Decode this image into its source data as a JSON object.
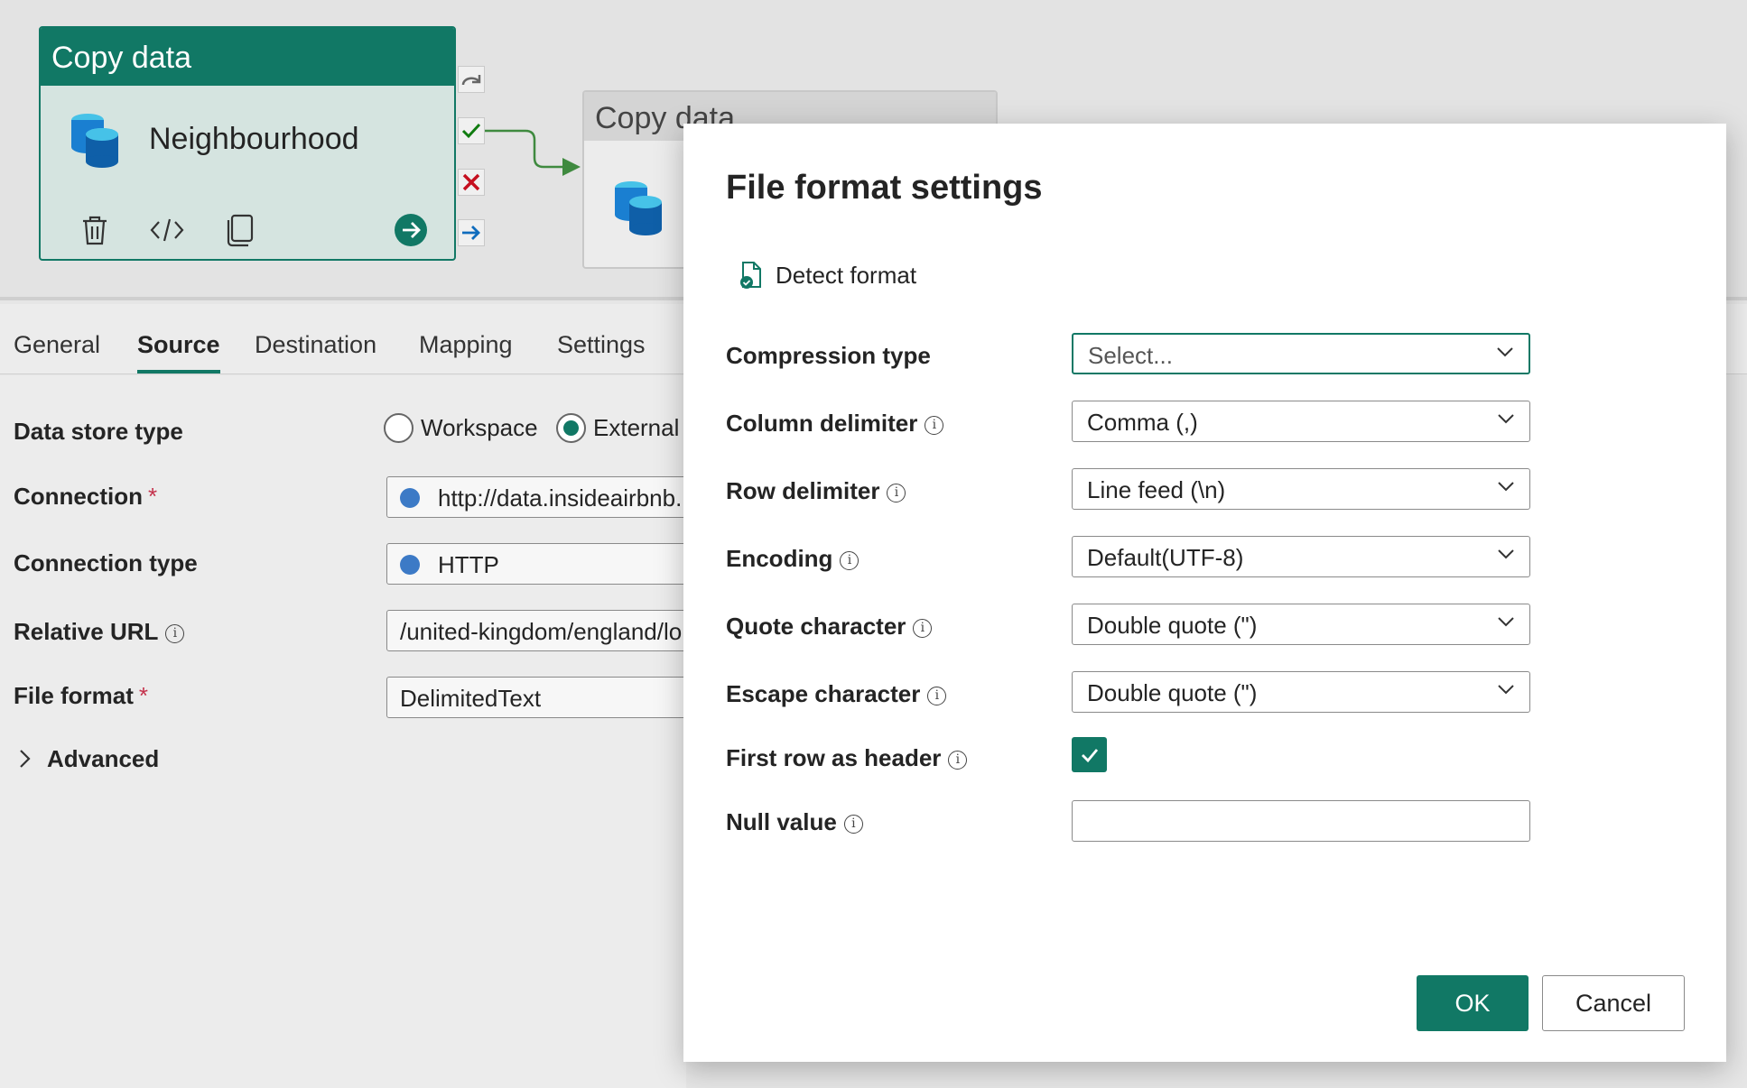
{
  "pipeline": {
    "node1": {
      "header": "Copy data",
      "title": "Neighbourhood"
    },
    "node2": {
      "header": "Copy data"
    }
  },
  "tabs": [
    {
      "label": "General"
    },
    {
      "label": "Source"
    },
    {
      "label": "Destination"
    },
    {
      "label": "Mapping"
    },
    {
      "label": "Settings"
    }
  ],
  "source": {
    "data_store_type_label": "Data store type",
    "workspace_option": "Workspace",
    "external_option": "External",
    "connection_label": "Connection",
    "connection_value": "http://data.insideairbnb.",
    "connection_type_label": "Connection type",
    "connection_type_value": "HTTP",
    "relative_url_label": "Relative URL",
    "relative_url_value": "/united-kingdom/england/lo",
    "file_format_label": "File format",
    "file_format_value": "DelimitedText",
    "required_mark": "*",
    "advanced_label": "Advanced"
  },
  "dialog": {
    "title": "File format settings",
    "detect_format": "Detect format",
    "compression_type_label": "Compression type",
    "compression_type_placeholder": "Select...",
    "column_delimiter_label": "Column delimiter",
    "column_delimiter_value": "Comma (,)",
    "row_delimiter_label": "Row delimiter",
    "row_delimiter_value": "Line feed (\\n)",
    "encoding_label": "Encoding",
    "encoding_value": "Default(UTF-8)",
    "quote_character_label": "Quote character",
    "quote_character_value": "Double quote (\")",
    "escape_character_label": "Escape character",
    "escape_character_value": "Double quote (\")",
    "first_row_header_label": "First row as header",
    "null_value_label": "Null value",
    "null_value": "",
    "info_glyph": "i",
    "ok_label": "OK",
    "cancel_label": "Cancel"
  },
  "colors": {
    "accent": "#117865",
    "required": "#c4314b"
  }
}
